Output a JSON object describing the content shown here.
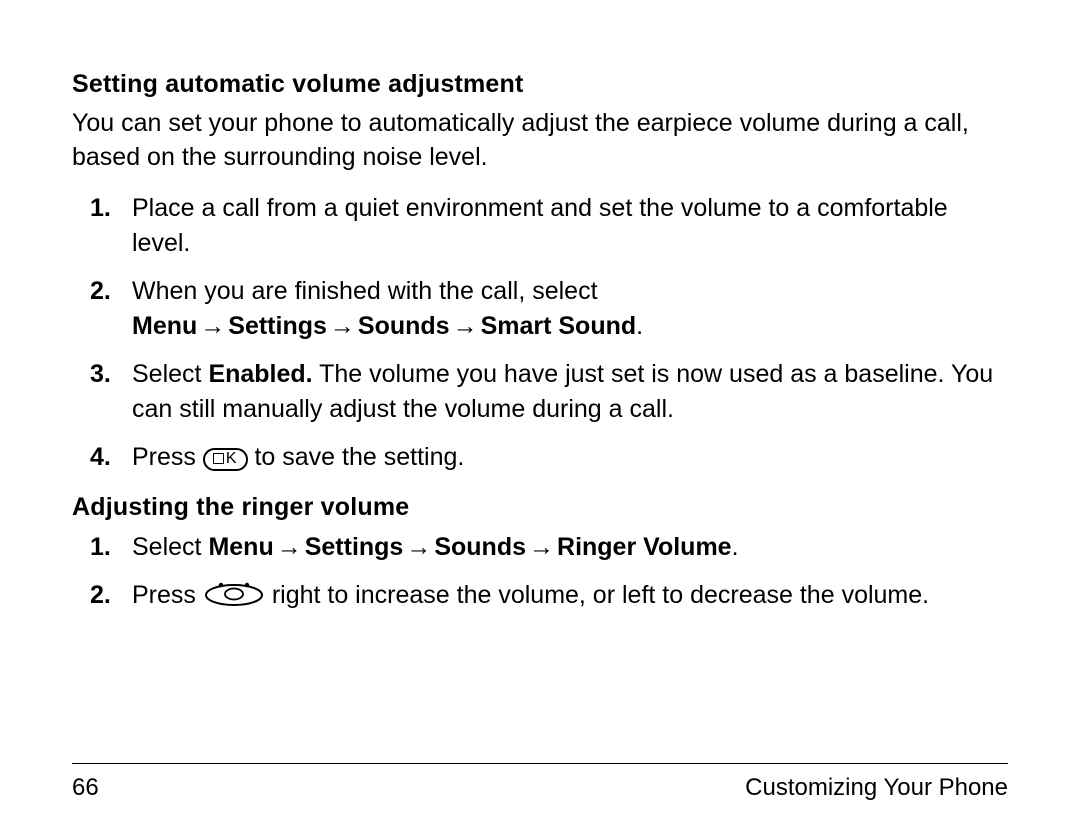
{
  "arrow": "→",
  "section1": {
    "heading": "Setting automatic volume adjustment",
    "intro": "You can set your phone to automatically adjust the earpiece volume during a call, based on the surrounding noise level.",
    "steps": [
      {
        "num": "1.",
        "text_a": "Place a call from a quiet environment and set the volume to a comfortable level."
      },
      {
        "num": "2.",
        "text_a": "When you are finished with the call, select ",
        "bold_parts": [
          "Menu",
          "Settings",
          "Sounds",
          "Smart Sound"
        ],
        "trail": "."
      },
      {
        "num": "3.",
        "pre": "Select ",
        "bold_a": "Enabled.",
        "post": " The volume you have just set is now used as a baseline. You can still manually adjust the volume during a call."
      },
      {
        "num": "4.",
        "pre": "Press ",
        "icon": "ok",
        "ok_label": "K",
        "post": " to save the setting."
      }
    ]
  },
  "section2": {
    "heading": "Adjusting the ringer volume",
    "steps": [
      {
        "num": "1.",
        "pre": "Select ",
        "bold_parts": [
          "Menu",
          "Settings",
          "Sounds",
          "Ringer Volume"
        ],
        "trail": "."
      },
      {
        "num": "2.",
        "pre": "Press ",
        "icon": "nav",
        "post": " right to increase the volume, or left to decrease the volume."
      }
    ]
  },
  "footer": {
    "page_number": "66",
    "section_title": "Customizing Your Phone"
  }
}
